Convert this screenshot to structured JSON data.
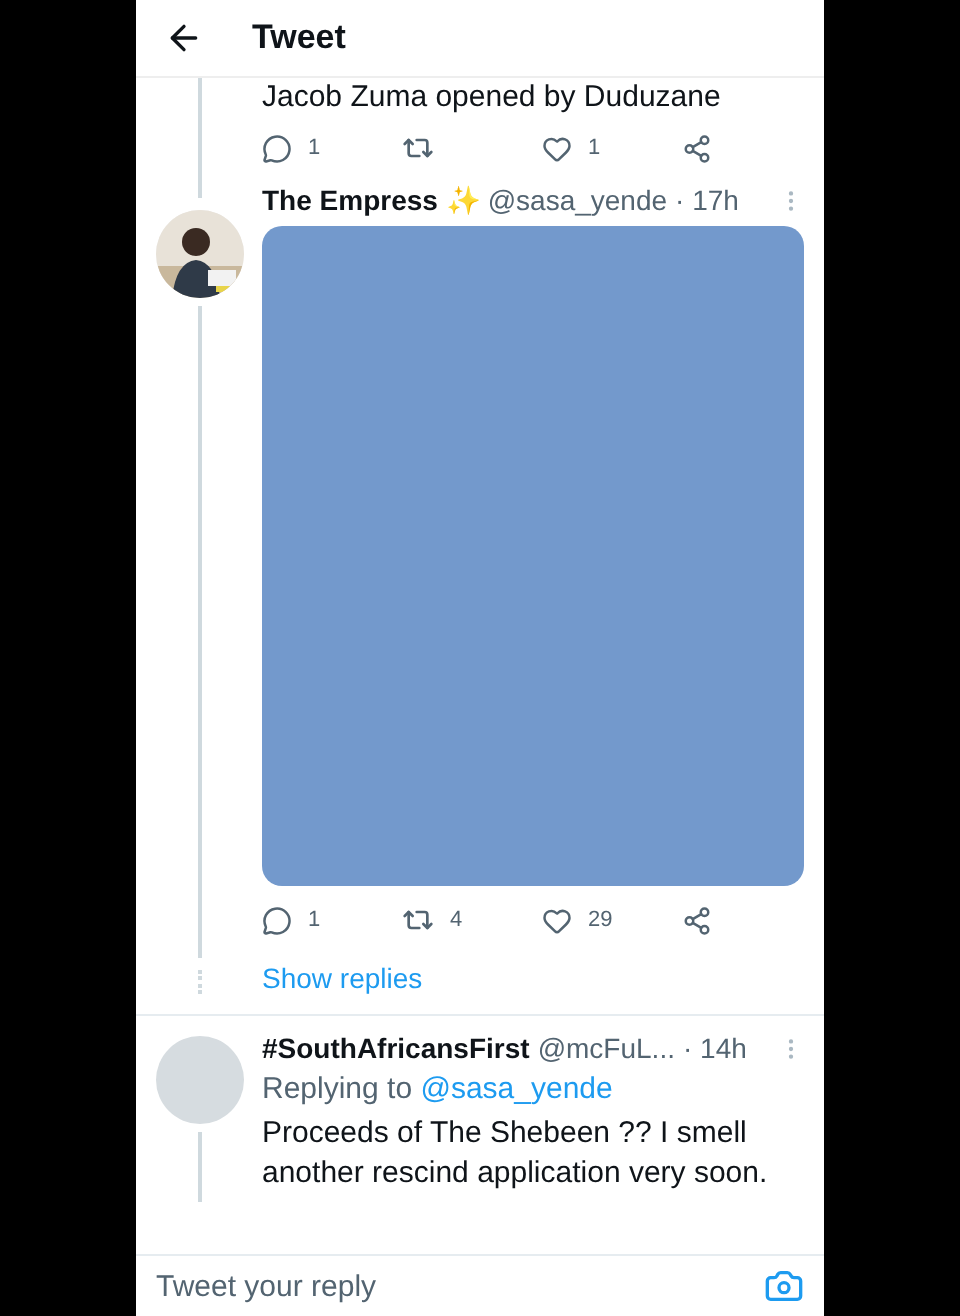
{
  "header": {
    "title": "Tweet"
  },
  "previous_tweet": {
    "text": "Jacob Zuma opened by Duduzane",
    "actions": {
      "replies": "1",
      "likes": "1"
    }
  },
  "tweets": [
    {
      "name": "The Empress ✨",
      "handle": "@sasa_yende",
      "time": "· 17h",
      "actions": {
        "replies": "1",
        "retweets": "4",
        "likes": "29"
      },
      "show_replies": "Show replies"
    },
    {
      "name": "#SouthAfricansFirst",
      "handle": "@mcFuL...",
      "time": "· 14h",
      "avatar": {
        "kind": "blank"
      },
      "replying_to": "Replying to",
      "reply_handle": "@sasa_yende",
      "text": "Proceeds of The Shebeen ?? I smell another rescind application very soon."
    }
  ],
  "reply_bar": {
    "placeholder": "Tweet your reply"
  }
}
